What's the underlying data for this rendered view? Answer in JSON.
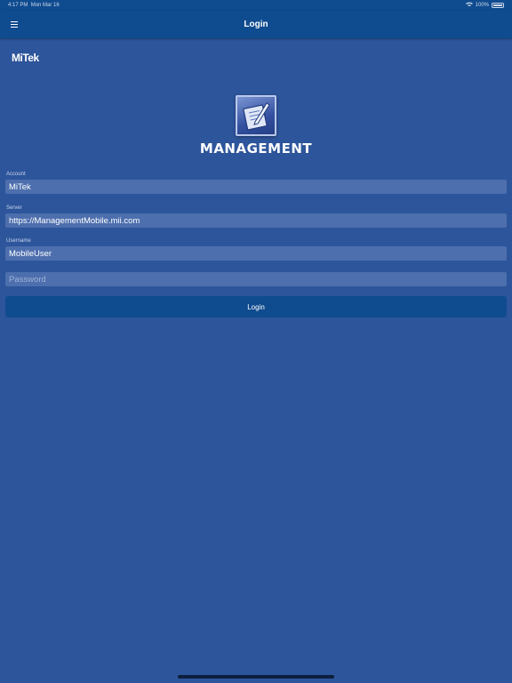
{
  "status_bar": {
    "time": "4:17 PM",
    "date": "Mon Mar 16",
    "battery_percent": "100%"
  },
  "nav": {
    "title": "Login",
    "menu_icon": "hamburger-menu-icon"
  },
  "brand": {
    "name": "MiTek"
  },
  "app": {
    "name": "MANAGEMENT",
    "logo_icon": "clipboard-pencil-icon"
  },
  "form": {
    "account": {
      "label": "Account",
      "value": "MiTek"
    },
    "server": {
      "label": "Server",
      "value": "https://ManagementMobile.mii.com"
    },
    "username": {
      "label": "Username",
      "value": "MobileUser"
    },
    "password": {
      "placeholder": "Password",
      "value": ""
    },
    "login_button": "Login"
  },
  "colors": {
    "background": "#2d559b",
    "nav_bar": "#0f4b8f",
    "field_bg": "#4d6fae",
    "button": "#0f4b8f"
  }
}
